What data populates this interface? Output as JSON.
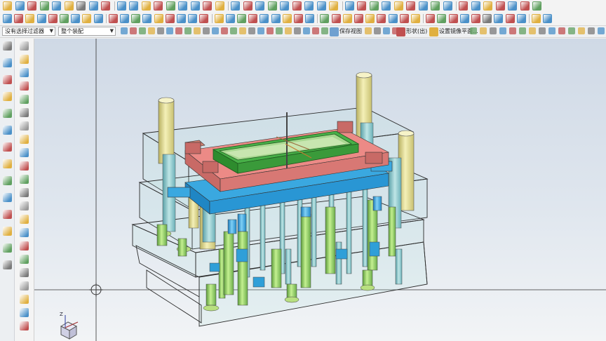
{
  "toolbar": {
    "selection_filter": "没有选择过滤器",
    "assembly_scope": "整个装配",
    "save_view_label": "保存视图",
    "shape_label": "形状(出)",
    "set_mirror_plane_label": "设置镜像平面..."
  },
  "toolbar_icons": {
    "row1_colors": [
      "#e0b040",
      "#4a90c8",
      "#c05050",
      "#60a060",
      "#4a90c8",
      "#e0b040",
      "#7a7a7a",
      "#4a90c8",
      "#c05050",
      "#4a90c8",
      "#4a90c8",
      "#e0b040",
      "#c05050",
      "#60a060",
      "#4a90c8",
      "#4a90c8",
      "#c05050",
      "#e0b040",
      "#4a90c8",
      "#c05050",
      "#4a90c8",
      "#60a060",
      "#4a90c8",
      "#c05050",
      "#4a90c8",
      "#4a90c8",
      "#e0b040",
      "#4a90c8",
      "#c05050",
      "#60a060",
      "#4a90c8",
      "#e0b040",
      "#c05050",
      "#4a90c8",
      "#60a060",
      "#4a90c8",
      "#c05050",
      "#4a90c8",
      "#e0b040",
      "#c05050",
      "#4a90c8",
      "#c05050",
      "#60a060"
    ],
    "row2_colors": [
      "#4a90c8",
      "#c05050",
      "#e0b040",
      "#4a90c8",
      "#c05050",
      "#60a060",
      "#4a90c8",
      "#e0b040",
      "#4a90c8",
      "#c05050",
      "#4a90c8",
      "#60a060",
      "#4a90c8",
      "#e0b040",
      "#c05050",
      "#4a90c8",
      "#4a90c8",
      "#c05050",
      "#e0b040",
      "#4a90c8",
      "#60a060",
      "#c05050",
      "#4a90c8",
      "#4a90c8",
      "#e0b040",
      "#c05050",
      "#4a90c8",
      "#60a060",
      "#c05050",
      "#e0b040",
      "#c05050",
      "#e0b040",
      "#c05050",
      "#4a90c8",
      "#c05050",
      "#e0b040",
      "#c05050",
      "#60a060",
      "#c05050",
      "#4a90c8",
      "#c05050",
      "#7a7a7a",
      "#4a90c8",
      "#c05050",
      "#4a90c8",
      "#e0b040",
      "#4a90c8"
    ]
  },
  "leftbar_icons": [
    "gear-icon",
    "parts-navigator-icon",
    "assembly-navigator-icon",
    "constraint-navigator-icon",
    "history-icon",
    "reuse-library-icon",
    "web-browser-icon",
    "history-clock-icon",
    "process-icon",
    "roles-icon",
    "system-materials-icon",
    "palette-icon",
    "analysis-icon",
    "tools-icon"
  ],
  "colors": {
    "plate_edge": "#2a2a2a",
    "cavity_red": "#e88080",
    "cavity_green": "#3fa83f",
    "pin_blue": "#2f9fd8",
    "pillar_yellow": "#e8e19a",
    "pillar_green": "#9fd46f"
  }
}
